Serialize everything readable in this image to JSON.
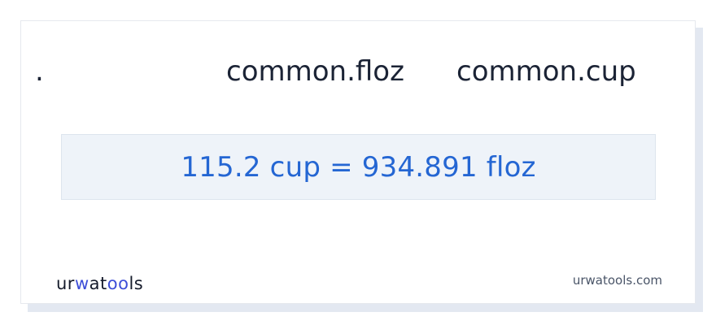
{
  "converter": {
    "bullet": ".",
    "from_unit": "common.floz",
    "to_unit": "common.cup",
    "result": "115.2 cup = 934.891 floz"
  },
  "footer": {
    "logo_part1": "ur",
    "logo_accent": "w",
    "logo_part2": "at",
    "logo_accent2": "oo",
    "logo_part3": "ls",
    "site": "urwatools.com"
  },
  "colors": {
    "accent": "#2466d3",
    "result_bg": "#eef3f9",
    "text": "#1b2335"
  }
}
